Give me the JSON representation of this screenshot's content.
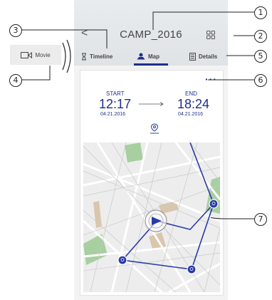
{
  "header": {
    "title": "CAMP_2016",
    "back_label": "<"
  },
  "tabs": [
    {
      "label": "Timeline"
    },
    {
      "label": "Map",
      "active": true
    },
    {
      "label": "Details"
    }
  ],
  "movie_button": {
    "label": "Movie"
  },
  "trip": {
    "start_label": "START",
    "start_time": "12:17",
    "start_date": "04.21.2016",
    "end_label": "END",
    "end_time": "18:24",
    "end_date": "04.21.2016",
    "more_label": "···"
  },
  "callouts": [
    "1",
    "2",
    "3",
    "4",
    "5",
    "6",
    "7"
  ],
  "colors": {
    "accent": "#1c2f8a",
    "route": "#2a3aa8",
    "park": "#a8cfa0",
    "building": "#d9c6ad"
  }
}
